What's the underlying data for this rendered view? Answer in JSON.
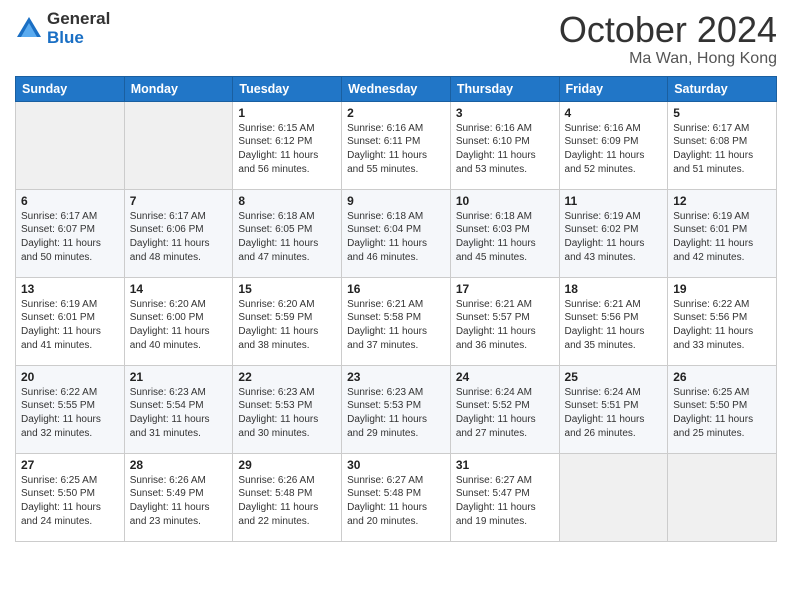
{
  "logo": {
    "general": "General",
    "blue": "Blue"
  },
  "header": {
    "month": "October 2024",
    "location": "Ma Wan, Hong Kong"
  },
  "weekdays": [
    "Sunday",
    "Monday",
    "Tuesday",
    "Wednesday",
    "Thursday",
    "Friday",
    "Saturday"
  ],
  "weeks": [
    [
      {
        "day": "",
        "info": ""
      },
      {
        "day": "",
        "info": ""
      },
      {
        "day": "1",
        "info": "Sunrise: 6:15 AM\nSunset: 6:12 PM\nDaylight: 11 hours and 56 minutes."
      },
      {
        "day": "2",
        "info": "Sunrise: 6:16 AM\nSunset: 6:11 PM\nDaylight: 11 hours and 55 minutes."
      },
      {
        "day": "3",
        "info": "Sunrise: 6:16 AM\nSunset: 6:10 PM\nDaylight: 11 hours and 53 minutes."
      },
      {
        "day": "4",
        "info": "Sunrise: 6:16 AM\nSunset: 6:09 PM\nDaylight: 11 hours and 52 minutes."
      },
      {
        "day": "5",
        "info": "Sunrise: 6:17 AM\nSunset: 6:08 PM\nDaylight: 11 hours and 51 minutes."
      }
    ],
    [
      {
        "day": "6",
        "info": "Sunrise: 6:17 AM\nSunset: 6:07 PM\nDaylight: 11 hours and 50 minutes."
      },
      {
        "day": "7",
        "info": "Sunrise: 6:17 AM\nSunset: 6:06 PM\nDaylight: 11 hours and 48 minutes."
      },
      {
        "day": "8",
        "info": "Sunrise: 6:18 AM\nSunset: 6:05 PM\nDaylight: 11 hours and 47 minutes."
      },
      {
        "day": "9",
        "info": "Sunrise: 6:18 AM\nSunset: 6:04 PM\nDaylight: 11 hours and 46 minutes."
      },
      {
        "day": "10",
        "info": "Sunrise: 6:18 AM\nSunset: 6:03 PM\nDaylight: 11 hours and 45 minutes."
      },
      {
        "day": "11",
        "info": "Sunrise: 6:19 AM\nSunset: 6:02 PM\nDaylight: 11 hours and 43 minutes."
      },
      {
        "day": "12",
        "info": "Sunrise: 6:19 AM\nSunset: 6:01 PM\nDaylight: 11 hours and 42 minutes."
      }
    ],
    [
      {
        "day": "13",
        "info": "Sunrise: 6:19 AM\nSunset: 6:01 PM\nDaylight: 11 hours and 41 minutes."
      },
      {
        "day": "14",
        "info": "Sunrise: 6:20 AM\nSunset: 6:00 PM\nDaylight: 11 hours and 40 minutes."
      },
      {
        "day": "15",
        "info": "Sunrise: 6:20 AM\nSunset: 5:59 PM\nDaylight: 11 hours and 38 minutes."
      },
      {
        "day": "16",
        "info": "Sunrise: 6:21 AM\nSunset: 5:58 PM\nDaylight: 11 hours and 37 minutes."
      },
      {
        "day": "17",
        "info": "Sunrise: 6:21 AM\nSunset: 5:57 PM\nDaylight: 11 hours and 36 minutes."
      },
      {
        "day": "18",
        "info": "Sunrise: 6:21 AM\nSunset: 5:56 PM\nDaylight: 11 hours and 35 minutes."
      },
      {
        "day": "19",
        "info": "Sunrise: 6:22 AM\nSunset: 5:56 PM\nDaylight: 11 hours and 33 minutes."
      }
    ],
    [
      {
        "day": "20",
        "info": "Sunrise: 6:22 AM\nSunset: 5:55 PM\nDaylight: 11 hours and 32 minutes."
      },
      {
        "day": "21",
        "info": "Sunrise: 6:23 AM\nSunset: 5:54 PM\nDaylight: 11 hours and 31 minutes."
      },
      {
        "day": "22",
        "info": "Sunrise: 6:23 AM\nSunset: 5:53 PM\nDaylight: 11 hours and 30 minutes."
      },
      {
        "day": "23",
        "info": "Sunrise: 6:23 AM\nSunset: 5:53 PM\nDaylight: 11 hours and 29 minutes."
      },
      {
        "day": "24",
        "info": "Sunrise: 6:24 AM\nSunset: 5:52 PM\nDaylight: 11 hours and 27 minutes."
      },
      {
        "day": "25",
        "info": "Sunrise: 6:24 AM\nSunset: 5:51 PM\nDaylight: 11 hours and 26 minutes."
      },
      {
        "day": "26",
        "info": "Sunrise: 6:25 AM\nSunset: 5:50 PM\nDaylight: 11 hours and 25 minutes."
      }
    ],
    [
      {
        "day": "27",
        "info": "Sunrise: 6:25 AM\nSunset: 5:50 PM\nDaylight: 11 hours and 24 minutes."
      },
      {
        "day": "28",
        "info": "Sunrise: 6:26 AM\nSunset: 5:49 PM\nDaylight: 11 hours and 23 minutes."
      },
      {
        "day": "29",
        "info": "Sunrise: 6:26 AM\nSunset: 5:48 PM\nDaylight: 11 hours and 22 minutes."
      },
      {
        "day": "30",
        "info": "Sunrise: 6:27 AM\nSunset: 5:48 PM\nDaylight: 11 hours and 20 minutes."
      },
      {
        "day": "31",
        "info": "Sunrise: 6:27 AM\nSunset: 5:47 PM\nDaylight: 11 hours and 19 minutes."
      },
      {
        "day": "",
        "info": ""
      },
      {
        "day": "",
        "info": ""
      }
    ]
  ]
}
